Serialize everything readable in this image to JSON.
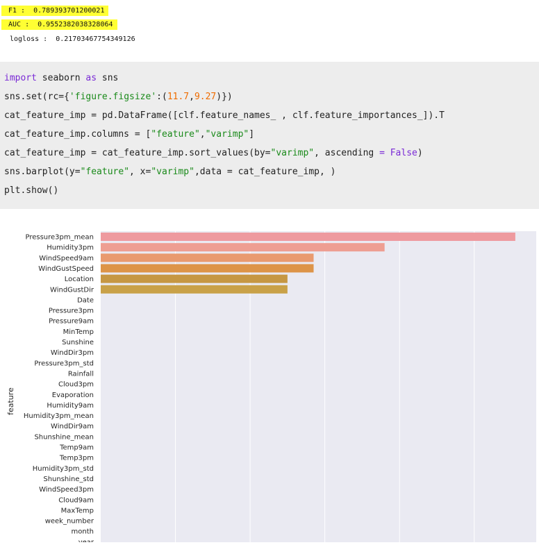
{
  "metrics": {
    "f1": "F1 :  0.789393701200021",
    "auc": "AUC :  0.9552382038328064",
    "logloss": "logloss :  0.21703467754349126"
  },
  "code": {
    "line1": {
      "kw1": "import",
      "t1": " seaborn ",
      "kw2": "as",
      "t2": " sns"
    },
    "line2": {
      "t1": "sns.set(rc={",
      "s1": "'figure.figsize'",
      "t2": ":(",
      "n1": "11.7",
      "t3": ",",
      "n2": "9.27",
      "t4": ")})"
    },
    "line3": "cat_feature_imp = pd.DataFrame([clf.feature_names_ , clf.feature_importances_]).T",
    "line4": {
      "t1": "cat_feature_imp.columns = [",
      "s1": "\"feature\"",
      "t2": ",",
      "s2": "\"varimp\"",
      "t3": "]"
    },
    "line5": {
      "t1": "cat_feature_imp = cat_feature_imp.sort_values(by=",
      "s1": "\"varimp\"",
      "t2": ", ascending ",
      "k1": "=",
      "t3": " ",
      "k2": "False",
      "t4": ")"
    },
    "line6": {
      "t1": "sns.barplot(y=",
      "s1": "\"feature\"",
      "t2": ", x=",
      "s2": "\"varimp\"",
      "t3": ",data = cat_feature_imp, )"
    },
    "line7": "plt.show()"
  },
  "chart_data": {
    "type": "bar",
    "orientation": "horizontal",
    "ylabel": "feature",
    "xlabel": "",
    "categories": [
      "Pressure3pm_mean",
      "Humidity3pm",
      "WindSpeed9am",
      "WindGustSpeed",
      "Location",
      "WindGustDir",
      "Date",
      "Pressure3pm",
      "Pressure9am",
      "MinTemp",
      "Sunshine",
      "WindDir3pm",
      "Pressure3pm_std",
      "Rainfall",
      "Cloud3pm",
      "Evaporation",
      "Humidity9am",
      "Humidity3pm_mean",
      "WindDir9am",
      "Shunshine_mean",
      "Temp9am",
      "Temp3pm",
      "Humidity3pm_std",
      "Shunshine_std",
      "WindSpeed3pm",
      "Cloud9am",
      "MaxTemp",
      "week_number",
      "month",
      "year"
    ],
    "values": [
      55.5,
      38.0,
      28.5,
      28.5,
      25.0,
      25.0,
      0,
      0,
      0,
      0,
      0,
      0,
      0,
      0,
      0,
      0,
      0,
      0,
      0,
      0,
      0,
      0,
      0,
      0,
      0,
      0,
      0,
      0,
      0,
      0
    ],
    "xlim": [
      0,
      58.3
    ],
    "xgrid_ticks": [
      10,
      20,
      30,
      40,
      50
    ],
    "grid": true,
    "style": "seaborn darkgrid",
    "colors": [
      "#ee9a9f",
      "#ee9e92",
      "#e99a6f",
      "#dd9448",
      "#c69743",
      "#c9a148"
    ],
    "background": "#eaeaf2"
  }
}
